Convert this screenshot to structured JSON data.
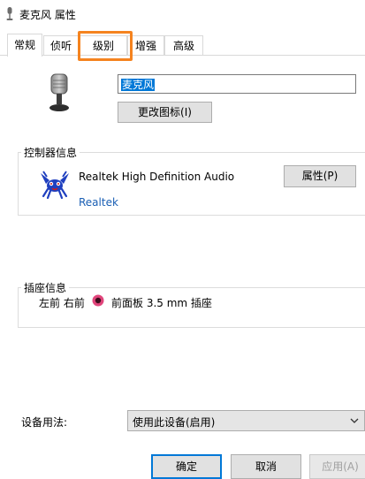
{
  "window": {
    "title": "麦克风 属性"
  },
  "tabs": [
    {
      "label": "常规",
      "active": true
    },
    {
      "label": "侦听",
      "active": false
    },
    {
      "label": "级别",
      "active": false,
      "highlighted": true
    },
    {
      "label": "增强",
      "active": false
    },
    {
      "label": "高级",
      "active": false
    }
  ],
  "device": {
    "name_value": "麦克风",
    "change_icon_label": "更改图标(I)",
    "icon": "microphone-icon"
  },
  "controller": {
    "section_title": "控制器信息",
    "name": "Realtek High Definition Audio",
    "vendor": "Realtek",
    "properties_label": "属性(P)",
    "icon": "realtek-crab-icon"
  },
  "jack": {
    "section_title": "插座信息",
    "channels": "左前 右前",
    "location": "前面板 3.5 mm 插座",
    "jack_color": "#e0457b"
  },
  "usage": {
    "label": "设备用法:",
    "selected": "使用此设备(启用)"
  },
  "footer": {
    "ok_label": "确定",
    "cancel_label": "取消",
    "apply_label": "应用(A)"
  },
  "colors": {
    "accent": "#0078d7",
    "highlight": "#f5831f",
    "realtek_blue": "#1f3fbf",
    "realtek_red": "#d11b1b"
  }
}
